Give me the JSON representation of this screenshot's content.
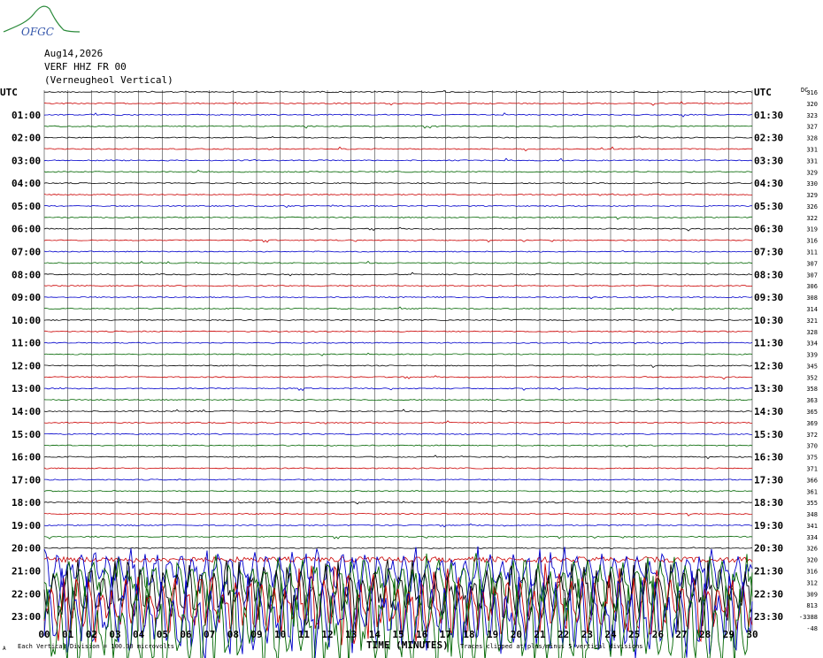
{
  "logo": {
    "text": "OFGC"
  },
  "header": {
    "date": "Aug14,2026",
    "station": "VERF HHZ FR 00",
    "location": "(Verneugheol Vertical)"
  },
  "axes": {
    "left_title": "UTC",
    "right_title": "UTC",
    "dc_title": "DC",
    "xlabel": "TIME (MINUTES)",
    "footer_note": "Each Vertical Division = 100.00 microvolts",
    "footer_traces": "Traces clipped at plus/minus 5 vertical divisions",
    "corner_mark": "A"
  },
  "chart_data": {
    "type": "line",
    "title": "VERF HHZ FR 00 (Verneugheol Vertical)",
    "xlabel": "TIME (MINUTES)",
    "ylabel": "UTC",
    "xlim": [
      0,
      30
    ],
    "x_ticks": [
      "00",
      "01",
      "02",
      "03",
      "04",
      "05",
      "06",
      "07",
      "08",
      "09",
      "10",
      "11",
      "12",
      "13",
      "14",
      "15",
      "16",
      "17",
      "18",
      "19",
      "20",
      "21",
      "22",
      "23",
      "24",
      "25",
      "26",
      "27",
      "28",
      "29",
      "30"
    ],
    "left_hour_labels": [
      "UTC",
      "01:00",
      "02:00",
      "03:00",
      "04:00",
      "05:00",
      "06:00",
      "07:00",
      "08:00",
      "09:00",
      "10:00",
      "11:00",
      "12:00",
      "13:00",
      "14:00",
      "15:00",
      "16:00",
      "17:00",
      "18:00",
      "19:00",
      "20:00",
      "21:00",
      "22:00",
      "23:00"
    ],
    "right_hour_labels": [
      "UTC",
      "01:30",
      "02:30",
      "03:30",
      "04:30",
      "05:30",
      "06:30",
      "07:30",
      "08:30",
      "09:30",
      "10:30",
      "11:30",
      "12:30",
      "13:30",
      "14:30",
      "15:30",
      "16:30",
      "17:30",
      "18:30",
      "19:30",
      "20:30",
      "21:30",
      "22:30",
      "23:30"
    ],
    "dc_offsets": [
      316,
      320,
      323,
      327,
      328,
      331,
      331,
      329,
      330,
      329,
      326,
      322,
      319,
      316,
      311,
      307,
      307,
      306,
      308,
      314,
      321,
      328,
      334,
      339,
      345,
      352,
      358,
      363,
      365,
      369,
      372,
      370,
      375,
      371,
      366,
      361,
      355,
      348,
      341,
      334,
      326,
      320,
      316,
      312,
      309,
      813,
      -3388,
      -48
    ],
    "trace_colors": [
      "#000000",
      "#cc0000",
      "#0000cc",
      "#006600"
    ],
    "trace_count": 48,
    "grid": true,
    "amplitude_scale": "100.00 microvolts per vertical division",
    "clipping": "plus/minus 5 vertical divisions",
    "quiet_activity": "low-amplitude noise through 20:30",
    "active_traces_from": "20:30",
    "clipped_traces_from": "21:00"
  }
}
